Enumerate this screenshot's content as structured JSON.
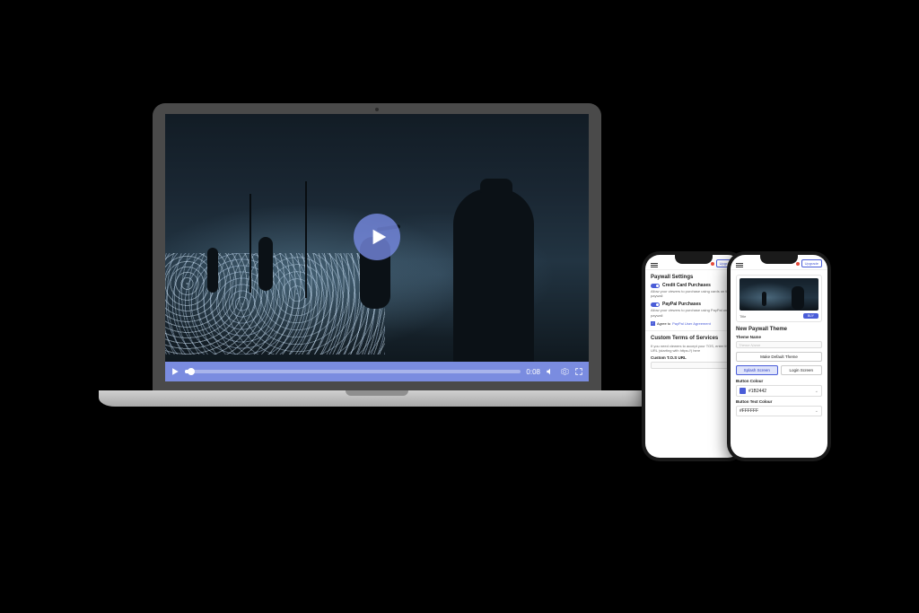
{
  "video": {
    "time_display": "0:08",
    "accent": "#7a8ce0"
  },
  "phone_header": {
    "upgrade_label": "Upgrade"
  },
  "paywall_settings": {
    "title": "Paywall Settings",
    "credit_card": {
      "label": "Credit Card Purchases",
      "desc": "Allow your viewers to purchase using cards on the paywall"
    },
    "paypal": {
      "label": "PayPal Purchases",
      "desc": "Allow your viewers to purchase using PayPal on the paywall"
    },
    "agree_prefix": "Agree to ",
    "agree_link": "PayPal User Agreement",
    "custom_tos_title": "Custom Terms of Services",
    "custom_tos_desc": "If you need viewers to accept your TOS, enter the URL (starting with https://) here",
    "custom_tos_url_label": "Custom T.O.S URL",
    "custom_tos_url_value": ""
  },
  "paywall_theme": {
    "preview_title_label": "Title",
    "preview_button_label": "BUY",
    "section_title": "New Paywall Theme",
    "theme_name_label": "Theme Name",
    "theme_name_placeholder": "Theme Name",
    "make_default_label": "Make Default Theme",
    "tab_splash": "Splash Screen",
    "tab_login": "Login Screen",
    "button_colour_label": "Button Colour",
    "button_colour_value": "#1B2442",
    "button_text_colour_label": "Button Text Colour",
    "button_text_colour_value": "#FFFFFF"
  }
}
